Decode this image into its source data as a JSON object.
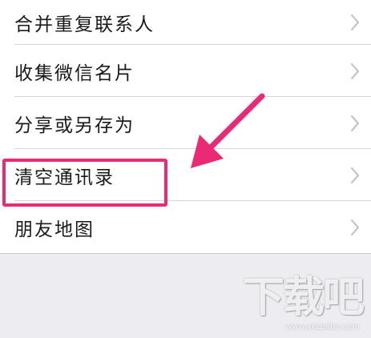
{
  "menu": {
    "items": [
      {
        "label": "合并重复联系人"
      },
      {
        "label": "收集微信名片"
      },
      {
        "label": "分享或另存为"
      },
      {
        "label": "清空通讯录"
      },
      {
        "label": "朋友地图"
      }
    ]
  },
  "icons": {
    "chevron": "chevron-right-icon"
  },
  "annotation": {
    "highlighted_item": "清空通讯录",
    "color": "#ea2a74"
  },
  "watermark": {
    "title": "下载吧",
    "url": "www.xiazaiba.com"
  },
  "colors": {
    "background": "#ececf1",
    "list_background": "#ffffff",
    "text": "#1a1a1a",
    "separator": "#d5d5d8",
    "chevron": "#c4c4c9"
  }
}
